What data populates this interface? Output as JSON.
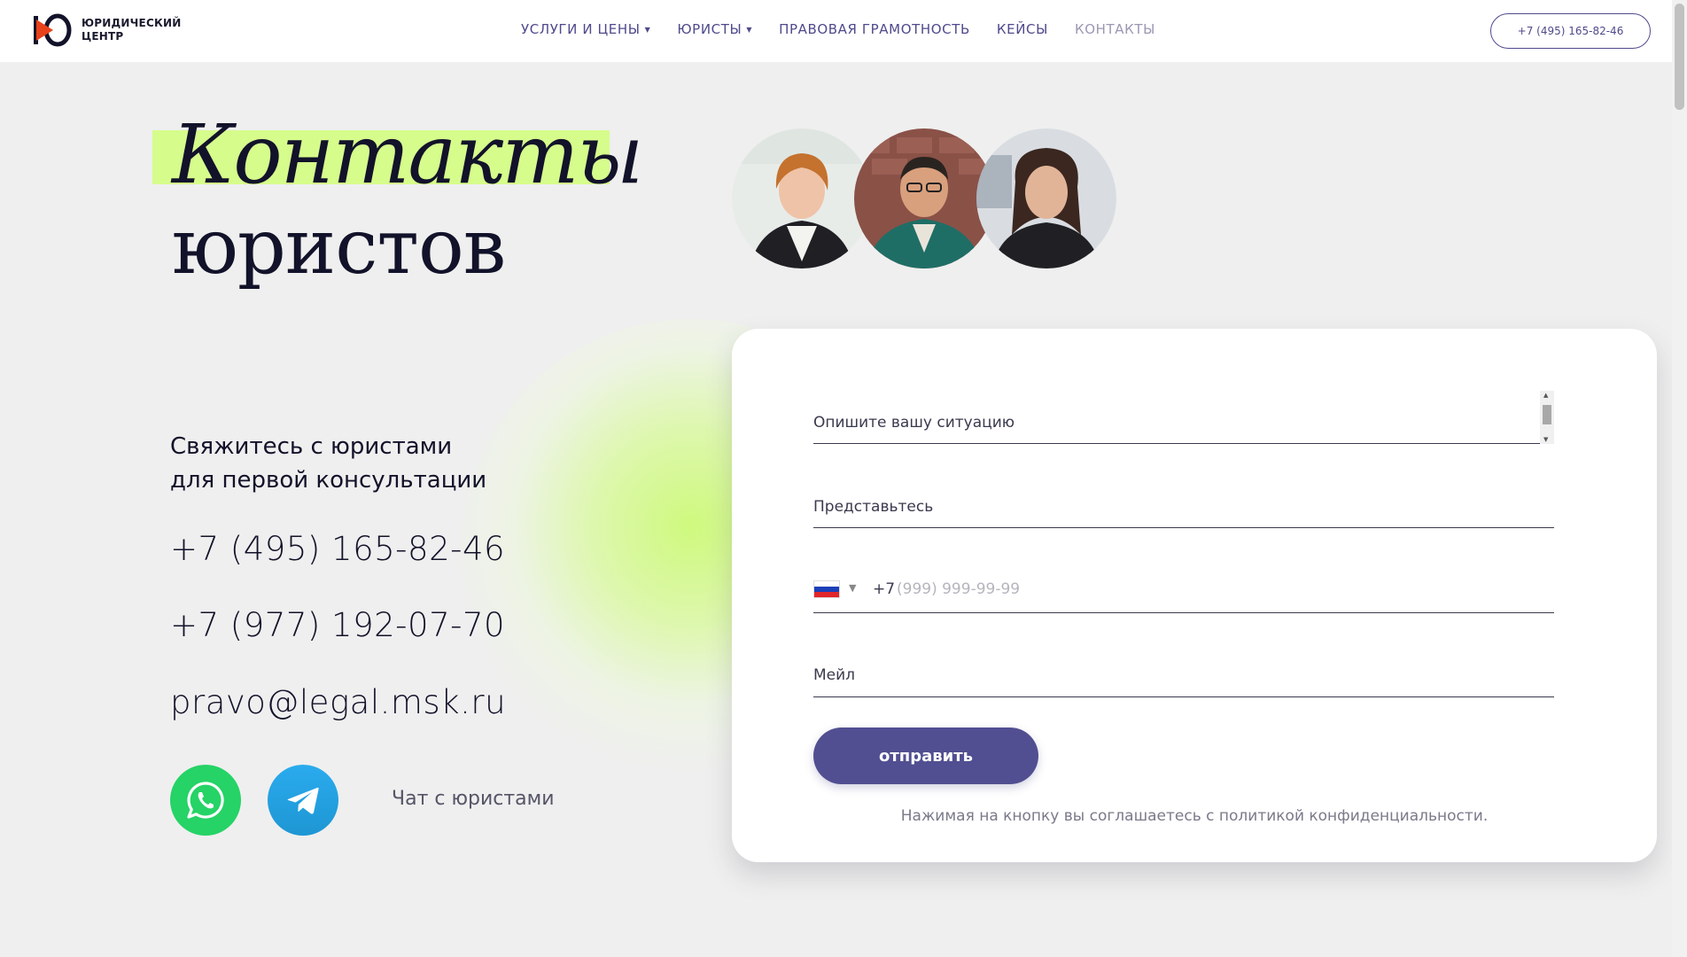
{
  "header": {
    "logo_mark": "Ю",
    "logo_text": "ЮРИДИЧЕСКИЙ\nЦЕНТР",
    "nav": [
      {
        "label": "УСЛУГИ И ЦЕНЫ",
        "dropdown": true,
        "active": false
      },
      {
        "label": "ЮРИСТЫ",
        "dropdown": true,
        "active": false
      },
      {
        "label": "ПРАВОВАЯ ГРАМОТНОСТЬ",
        "dropdown": false,
        "active": false
      },
      {
        "label": "КЕЙСЫ",
        "dropdown": false,
        "active": false
      },
      {
        "label": "КОНТАКТЫ",
        "dropdown": false,
        "active": true
      }
    ],
    "phone": "+7 (495) 165-82-46"
  },
  "hero": {
    "title_line1": "Контакты",
    "title_line2": "юристов",
    "highlight_color": "#d6fc8c"
  },
  "contacts": {
    "subtitle": "Свяжитесь с юристами\nдля первой консультации",
    "phone1": "+7 (495) 165-82-46",
    "phone2": "+7 (977) 192-07-70",
    "email": "pravo@legal.msk.ru",
    "whatsapp_icon": "whatsapp-icon",
    "telegram_icon": "telegram-icon",
    "chat_label": "Чат с юристами"
  },
  "form": {
    "situation_placeholder": "Опишите вашу ситуацию",
    "name_placeholder": "Представьтесь",
    "phone_country": "RU",
    "phone_prefix": "+7",
    "phone_placeholder": "(999) 999-99-99",
    "email_placeholder": "Мейл",
    "submit_label": "отправить",
    "policy_text": "Нажимая на кнопку вы соглашаетесь с политикой конфиденциальности."
  },
  "colors": {
    "accent": "#514f91",
    "nav": "#4f4a8c",
    "whatsapp": "#25d366",
    "telegram": "#2aabee",
    "logo_red": "#e8421c"
  }
}
